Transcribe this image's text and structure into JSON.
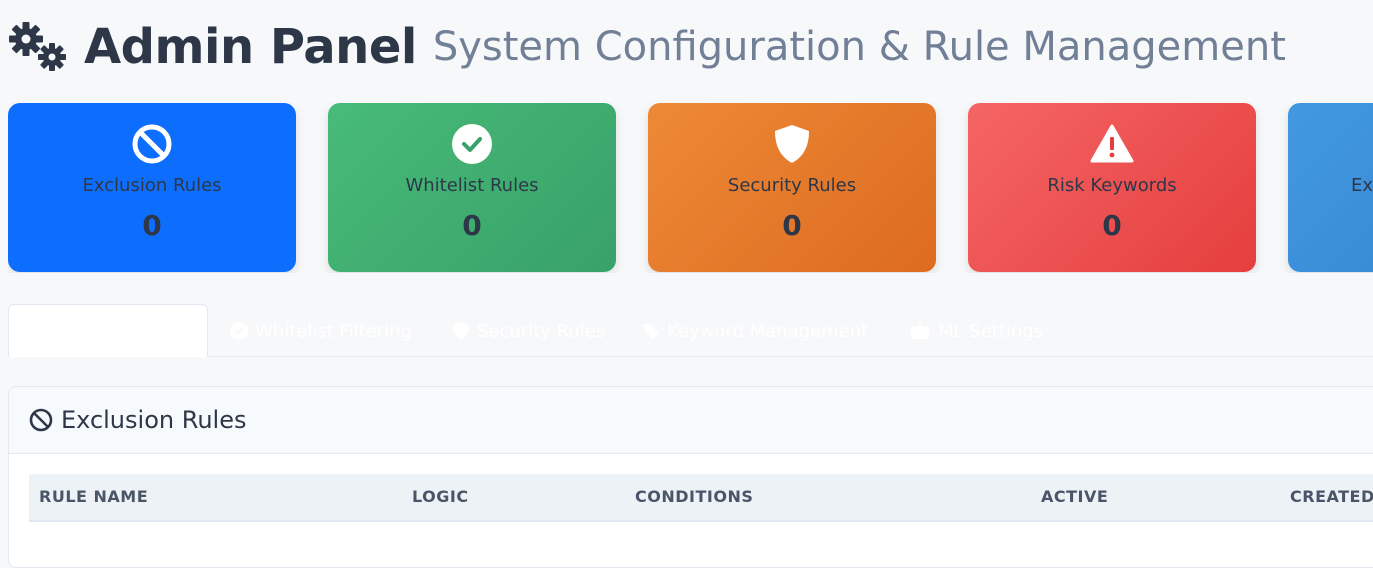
{
  "header": {
    "title": "Admin Panel",
    "subtitle": "System Configuration & Rule Management",
    "icon": "cogs-icon"
  },
  "stats": [
    {
      "label": "Exclusion Rules",
      "count": "0",
      "icon": "ban-icon",
      "color": "#0d6efd"
    },
    {
      "label": "Whitelist Rules",
      "count": "0",
      "icon": "check-circle-icon",
      "color": "#48bb78"
    },
    {
      "label": "Security Rules",
      "count": "0",
      "icon": "shield-icon",
      "color": "#ed8936"
    },
    {
      "label": "Risk Keywords",
      "count": "0",
      "icon": "warning-icon",
      "color": "#f56565"
    },
    {
      "label": "Exc",
      "count": "",
      "icon": "",
      "color": "#4299e1"
    }
  ],
  "tabs": [
    {
      "label": "",
      "active": true
    },
    {
      "label": "Whitelist Filtering",
      "icon": "check-circle-icon"
    },
    {
      "label": "Security Rules",
      "icon": "shield-icon"
    },
    {
      "label": "Keyword Management",
      "icon": "tags-icon"
    },
    {
      "label": "ML Settings",
      "icon": "robot-icon"
    }
  ],
  "panel": {
    "title": "Exclusion Rules",
    "icon": "ban-icon",
    "columns": [
      "RULE NAME",
      "LOGIC",
      "CONDITIONS",
      "ACTIVE",
      "CREATED"
    ]
  }
}
